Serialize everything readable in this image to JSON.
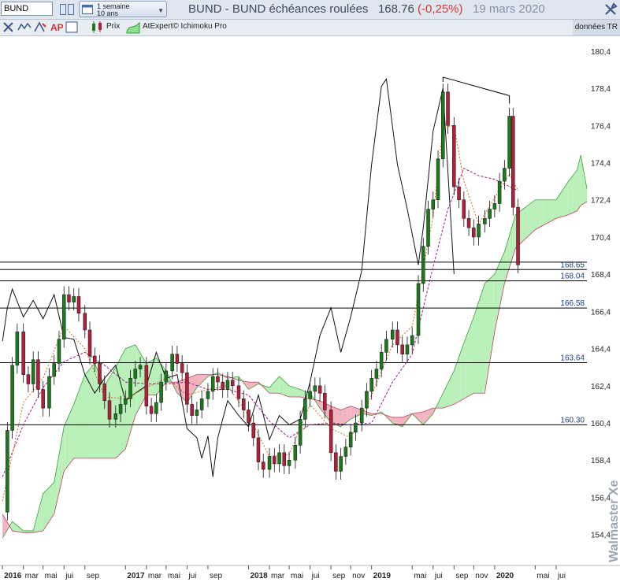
{
  "header": {
    "symbol": "BUND",
    "period_line1": "1 semaine",
    "period_line2": "10 ans",
    "title": "BUND - BUND échéances roulées",
    "price": "168.76",
    "change": "(-0,25%)",
    "date": "19 mars 2020"
  },
  "toolbar": {
    "price_label": "Prix",
    "indicator_label": "AtExpert© Ichimoku Pro",
    "data_mode": "données TR"
  },
  "watermark": "Walmaster Xe",
  "colors": {
    "kumo_bullish": "#b8f0b8",
    "kumo_bearish": "#f2b3c0",
    "candle_up": "#1b7a1b",
    "candle_down": "#b0203a",
    "kijun": "#2222cc",
    "tenkan": "#d07020",
    "chikou": "#9a1a8a"
  },
  "chart_data": {
    "type": "candlestick",
    "title": "BUND - BUND échéances roulées",
    "interval": "1 semaine",
    "y_ticks": [
      "180,4",
      "178,4",
      "176,4",
      "174,4",
      "172,4",
      "170,4",
      "168,4",
      "166,4",
      "164,4",
      "162,4",
      "160,4",
      "158,4",
      "156,4",
      "154,4"
    ],
    "ylim": [
      153.2,
      181.2
    ],
    "x_labels": [
      "2016",
      "mar",
      "mai",
      "jui",
      "sep",
      "2017",
      "mar",
      "mai",
      "jui",
      "sep",
      "2018",
      "mar",
      "mai",
      "jui",
      "sep",
      "nov",
      "2019",
      "mai",
      "jui",
      "sep",
      "nov",
      "2020",
      "mai",
      "jui"
    ],
    "x_label_dates": [
      2016.0,
      2016.17,
      2016.33,
      2016.5,
      2016.67,
      2017.0,
      2017.17,
      2017.33,
      2017.5,
      2017.67,
      2018.0,
      2018.17,
      2018.33,
      2018.5,
      2018.67,
      2018.83,
      2019.0,
      2019.33,
      2019.5,
      2019.67,
      2019.83,
      2020.0,
      2020.33,
      2020.5
    ],
    "xlim": [
      2015.98,
      2020.75
    ],
    "levels": [
      "168.65",
      "168.04",
      "166.58",
      "163.64",
      "160.30"
    ],
    "extra_levels": [
      169.05
    ],
    "close_series": [
      [
        2016.0,
        155.6
      ],
      [
        2016.04,
        160.0
      ],
      [
        2016.08,
        163.5
      ],
      [
        2016.12,
        165.3
      ],
      [
        2016.17,
        163.0
      ],
      [
        2016.21,
        162.5
      ],
      [
        2016.25,
        163.8
      ],
      [
        2016.29,
        162.2
      ],
      [
        2016.33,
        161.2
      ],
      [
        2016.38,
        162.9
      ],
      [
        2016.42,
        163.6
      ],
      [
        2016.46,
        164.9
      ],
      [
        2016.5,
        167.3
      ],
      [
        2016.54,
        166.9
      ],
      [
        2016.58,
        167.2
      ],
      [
        2016.62,
        166.3
      ],
      [
        2016.67,
        165.4
      ],
      [
        2016.71,
        164.0
      ],
      [
        2016.75,
        163.6
      ],
      [
        2016.79,
        162.5
      ],
      [
        2016.83,
        161.6
      ],
      [
        2016.87,
        160.6
      ],
      [
        2016.92,
        160.9
      ],
      [
        2016.96,
        161.4
      ],
      [
        2017.0,
        161.7
      ],
      [
        2017.04,
        162.8
      ],
      [
        2017.08,
        163.3
      ],
      [
        2017.12,
        163.5
      ],
      [
        2017.17,
        161.3
      ],
      [
        2017.21,
        160.9
      ],
      [
        2017.25,
        161.5
      ],
      [
        2017.29,
        162.6
      ],
      [
        2017.33,
        163.2
      ],
      [
        2017.38,
        164.1
      ],
      [
        2017.42,
        163.6
      ],
      [
        2017.46,
        163.1
      ],
      [
        2017.5,
        161.4
      ],
      [
        2017.54,
        160.8
      ],
      [
        2017.58,
        161.1
      ],
      [
        2017.62,
        161.7
      ],
      [
        2017.67,
        162.1
      ],
      [
        2017.71,
        162.9
      ],
      [
        2017.75,
        162.6
      ],
      [
        2017.79,
        162.2
      ],
      [
        2017.83,
        162.7
      ],
      [
        2017.87,
        162.4
      ],
      [
        2017.92,
        161.7
      ],
      [
        2017.96,
        161.1
      ],
      [
        2018.0,
        160.4
      ],
      [
        2018.04,
        159.6
      ],
      [
        2018.08,
        158.3
      ],
      [
        2018.12,
        157.9
      ],
      [
        2018.17,
        158.6
      ],
      [
        2018.21,
        158.2
      ],
      [
        2018.25,
        158.8
      ],
      [
        2018.29,
        158.1
      ],
      [
        2018.33,
        158.4
      ],
      [
        2018.38,
        159.2
      ],
      [
        2018.42,
        160.6
      ],
      [
        2018.46,
        161.7
      ],
      [
        2018.5,
        162.1
      ],
      [
        2018.54,
        162.4
      ],
      [
        2018.58,
        162.0
      ],
      [
        2018.62,
        161.1
      ],
      [
        2018.67,
        158.8
      ],
      [
        2018.71,
        157.8
      ],
      [
        2018.75,
        158.6
      ],
      [
        2018.79,
        159.1
      ],
      [
        2018.83,
        159.9
      ],
      [
        2018.87,
        160.4
      ],
      [
        2018.92,
        161.2
      ],
      [
        2018.96,
        162.1
      ],
      [
        2019.0,
        162.8
      ],
      [
        2019.04,
        163.3
      ],
      [
        2019.08,
        164.2
      ],
      [
        2019.12,
        164.9
      ],
      [
        2019.17,
        165.4
      ],
      [
        2019.21,
        164.6
      ],
      [
        2019.25,
        164.1
      ],
      [
        2019.29,
        164.6
      ],
      [
        2019.33,
        165.1
      ],
      [
        2019.38,
        167.9
      ],
      [
        2019.42,
        169.9
      ],
      [
        2019.46,
        171.9
      ],
      [
        2019.5,
        172.4
      ],
      [
        2019.54,
        174.6
      ],
      [
        2019.58,
        178.2
      ],
      [
        2019.62,
        176.4
      ],
      [
        2019.67,
        173.1
      ],
      [
        2019.71,
        172.4
      ],
      [
        2019.75,
        171.4
      ],
      [
        2019.79,
        170.9
      ],
      [
        2019.83,
        170.4
      ],
      [
        2019.87,
        171.1
      ],
      [
        2019.92,
        171.4
      ],
      [
        2019.96,
        171.9
      ],
      [
        2020.0,
        172.2
      ],
      [
        2020.04,
        173.4
      ],
      [
        2020.08,
        174.1
      ],
      [
        2020.12,
        176.9
      ],
      [
        2020.15,
        172.0
      ],
      [
        2020.19,
        168.9
      ]
    ],
    "tenkan_series": [
      [
        2016.0,
        156.2
      ],
      [
        2016.17,
        161.5
      ],
      [
        2016.33,
        162.8
      ],
      [
        2016.5,
        165.6
      ],
      [
        2016.67,
        164.4
      ],
      [
        2016.83,
        161.8
      ],
      [
        2017.0,
        161.7
      ],
      [
        2017.17,
        162.3
      ],
      [
        2017.33,
        162.8
      ],
      [
        2017.5,
        161.9
      ],
      [
        2017.67,
        162.2
      ],
      [
        2017.83,
        162.4
      ],
      [
        2018.0,
        160.8
      ],
      [
        2018.17,
        158.6
      ],
      [
        2018.33,
        158.7
      ],
      [
        2018.5,
        161.4
      ],
      [
        2018.67,
        160.1
      ],
      [
        2018.83,
        159.6
      ],
      [
        2019.0,
        161.9
      ],
      [
        2019.17,
        164.6
      ],
      [
        2019.33,
        165.6
      ],
      [
        2019.5,
        171.5
      ],
      [
        2019.58,
        176.3
      ],
      [
        2019.67,
        176.4
      ],
      [
        2019.75,
        173.4
      ],
      [
        2019.87,
        171.1
      ],
      [
        2020.0,
        172.5
      ],
      [
        2020.12,
        173.8
      ],
      [
        2020.19,
        172.9
      ]
    ],
    "kijun_series": [
      [
        2016.0,
        157.5
      ],
      [
        2016.17,
        160.3
      ],
      [
        2016.33,
        162.3
      ],
      [
        2016.5,
        163.7
      ],
      [
        2016.67,
        164.2
      ],
      [
        2016.83,
        163.5
      ],
      [
        2017.0,
        162.6
      ],
      [
        2017.17,
        162.5
      ],
      [
        2017.33,
        162.5
      ],
      [
        2017.5,
        162.6
      ],
      [
        2017.67,
        162.2
      ],
      [
        2017.83,
        162.2
      ],
      [
        2018.0,
        161.9
      ],
      [
        2018.17,
        160.5
      ],
      [
        2018.33,
        159.6
      ],
      [
        2018.5,
        160.3
      ],
      [
        2018.67,
        160.4
      ],
      [
        2018.83,
        160.3
      ],
      [
        2019.0,
        160.4
      ],
      [
        2019.17,
        162.6
      ],
      [
        2019.33,
        164.1
      ],
      [
        2019.5,
        168.8
      ],
      [
        2019.62,
        171.9
      ],
      [
        2019.75,
        174.1
      ],
      [
        2019.87,
        173.7
      ],
      [
        2020.0,
        173.5
      ],
      [
        2020.19,
        172.9
      ]
    ],
    "chikou_series": [
      [
        2016.0,
        164.8
      ],
      [
        2016.04,
        166.6
      ],
      [
        2016.08,
        167.6
      ],
      [
        2016.17,
        166.1
      ],
      [
        2016.25,
        167.0
      ],
      [
        2016.33,
        166.0
      ],
      [
        2016.42,
        167.3
      ],
      [
        2016.5,
        165.0
      ],
      [
        2016.58,
        164.9
      ],
      [
        2016.67,
        163.0
      ],
      [
        2016.75,
        162.0
      ],
      [
        2016.83,
        162.8
      ],
      [
        2016.92,
        163.5
      ],
      [
        2017.0,
        161.6
      ],
      [
        2017.08,
        162.0
      ],
      [
        2017.17,
        162.4
      ],
      [
        2017.25,
        164.2
      ],
      [
        2017.33,
        162.8
      ],
      [
        2017.42,
        163.0
      ],
      [
        2017.5,
        160.1
      ],
      [
        2017.58,
        159.6
      ],
      [
        2017.62,
        158.5
      ],
      [
        2017.67,
        159.7
      ],
      [
        2017.71,
        157.5
      ],
      [
        2017.75,
        159.6
      ],
      [
        2017.83,
        161.6
      ],
      [
        2017.92,
        160.8
      ],
      [
        2018.0,
        160.2
      ],
      [
        2018.08,
        161.9
      ],
      [
        2018.17,
        159.5
      ],
      [
        2018.25,
        160.8
      ],
      [
        2018.33,
        160.3
      ],
      [
        2018.42,
        160.6
      ],
      [
        2018.5,
        162.6
      ],
      [
        2018.58,
        165.1
      ],
      [
        2018.67,
        166.6
      ],
      [
        2018.75,
        164.2
      ],
      [
        2018.83,
        166.1
      ],
      [
        2018.92,
        168.6
      ],
      [
        2019.0,
        174.3
      ],
      [
        2019.08,
        178.5
      ],
      [
        2019.12,
        178.9
      ],
      [
        2019.21,
        174.3
      ],
      [
        2019.29,
        171.9
      ],
      [
        2019.38,
        168.9
      ],
      [
        2019.42,
        170.9
      ],
      [
        2019.5,
        176.1
      ],
      [
        2019.58,
        178.4
      ],
      [
        2019.67,
        168.4
      ]
    ],
    "span_a_series": [
      [
        2016.0,
        154.2
      ],
      [
        2016.08,
        155.1
      ],
      [
        2016.17,
        154.6
      ],
      [
        2016.25,
        154.6
      ],
      [
        2016.33,
        156.6
      ],
      [
        2016.42,
        157.2
      ],
      [
        2016.5,
        160.2
      ],
      [
        2016.58,
        161.4
      ],
      [
        2016.67,
        163.0
      ],
      [
        2016.75,
        163.6
      ],
      [
        2016.83,
        162.4
      ],
      [
        2016.92,
        163.4
      ],
      [
        2017.0,
        164.4
      ],
      [
        2017.08,
        164.6
      ],
      [
        2017.17,
        163.6
      ],
      [
        2017.25,
        163.9
      ],
      [
        2017.33,
        163.2
      ],
      [
        2017.42,
        162.0
      ],
      [
        2017.5,
        161.5
      ],
      [
        2017.58,
        162.3
      ],
      [
        2017.67,
        162.9
      ],
      [
        2017.75,
        163.1
      ],
      [
        2017.83,
        162.8
      ],
      [
        2017.92,
        162.9
      ],
      [
        2018.0,
        162.2
      ],
      [
        2018.08,
        162.5
      ],
      [
        2018.17,
        162.3
      ],
      [
        2018.25,
        162.9
      ],
      [
        2018.33,
        162.4
      ],
      [
        2018.42,
        162.2
      ],
      [
        2018.5,
        162.0
      ],
      [
        2018.58,
        161.2
      ],
      [
        2018.67,
        160.4
      ],
      [
        2018.75,
        160.2
      ],
      [
        2018.83,
        160.6
      ],
      [
        2018.92,
        160.9
      ],
      [
        2019.0,
        160.8
      ],
      [
        2019.08,
        161.0
      ],
      [
        2019.17,
        160.4
      ],
      [
        2019.25,
        160.2
      ],
      [
        2019.33,
        160.9
      ],
      [
        2019.42,
        160.3
      ],
      [
        2019.5,
        160.9
      ],
      [
        2019.58,
        162.0
      ],
      [
        2019.67,
        163.2
      ],
      [
        2019.75,
        164.7
      ],
      [
        2019.83,
        166.1
      ],
      [
        2019.92,
        167.9
      ],
      [
        2020.0,
        168.4
      ],
      [
        2020.08,
        169.6
      ],
      [
        2020.17,
        171.6
      ],
      [
        2020.33,
        172.4
      ],
      [
        2020.5,
        172.4
      ],
      [
        2020.6,
        173.4
      ],
      [
        2020.67,
        174.0
      ],
      [
        2020.7,
        174.8
      ],
      [
        2020.75,
        173.0
      ]
    ],
    "span_b_series": [
      [
        2016.0,
        155.5
      ],
      [
        2016.08,
        154.6
      ],
      [
        2016.17,
        154.5
      ],
      [
        2016.25,
        154.5
      ],
      [
        2016.33,
        154.6
      ],
      [
        2016.42,
        155.5
      ],
      [
        2016.5,
        157.8
      ],
      [
        2016.58,
        158.5
      ],
      [
        2016.67,
        158.5
      ],
      [
        2016.75,
        158.5
      ],
      [
        2016.83,
        158.5
      ],
      [
        2016.92,
        158.5
      ],
      [
        2017.0,
        159.0
      ],
      [
        2017.08,
        160.8
      ],
      [
        2017.17,
        161.9
      ],
      [
        2017.25,
        161.9
      ],
      [
        2017.33,
        162.6
      ],
      [
        2017.42,
        162.6
      ],
      [
        2017.5,
        162.8
      ],
      [
        2017.58,
        163.0
      ],
      [
        2017.67,
        163.0
      ],
      [
        2017.75,
        163.0
      ],
      [
        2017.83,
        162.9
      ],
      [
        2017.92,
        162.7
      ],
      [
        2018.0,
        162.6
      ],
      [
        2018.08,
        162.6
      ],
      [
        2018.17,
        162.0
      ],
      [
        2018.25,
        162.0
      ],
      [
        2018.33,
        161.8
      ],
      [
        2018.42,
        161.8
      ],
      [
        2018.5,
        161.7
      ],
      [
        2018.58,
        161.6
      ],
      [
        2018.67,
        161.3
      ],
      [
        2018.75,
        161.1
      ],
      [
        2018.83,
        161.3
      ],
      [
        2018.92,
        161.1
      ],
      [
        2019.0,
        160.9
      ],
      [
        2019.08,
        160.9
      ],
      [
        2019.17,
        160.7
      ],
      [
        2019.25,
        160.7
      ],
      [
        2019.33,
        160.9
      ],
      [
        2019.42,
        161.0
      ],
      [
        2019.5,
        161.2
      ],
      [
        2019.58,
        161.2
      ],
      [
        2019.67,
        161.4
      ],
      [
        2019.75,
        161.7
      ],
      [
        2019.83,
        162.0
      ],
      [
        2019.92,
        162.0
      ],
      [
        2020.0,
        165.3
      ],
      [
        2020.08,
        167.9
      ],
      [
        2020.17,
        169.8
      ],
      [
        2020.33,
        170.8
      ],
      [
        2020.5,
        171.4
      ],
      [
        2020.6,
        171.6
      ],
      [
        2020.67,
        171.8
      ],
      [
        2020.7,
        172.1
      ],
      [
        2020.75,
        172.3
      ]
    ],
    "trendline": [
      [
        2019.58,
        179.0
      ],
      [
        2020.12,
        178.0
      ]
    ]
  }
}
